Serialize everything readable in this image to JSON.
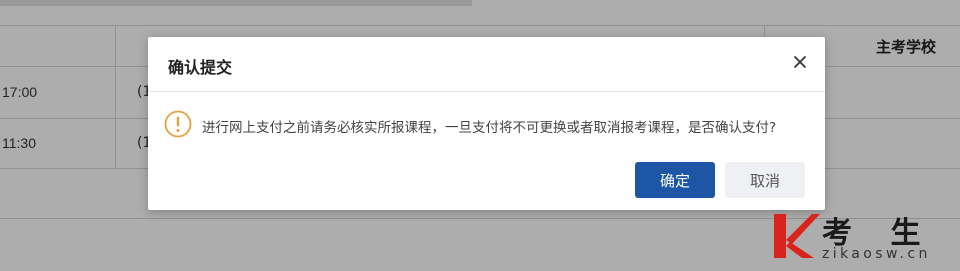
{
  "background": {
    "header_col_school": "主考学校",
    "rows": [
      {
        "time": "17:00",
        "paren": "(1"
      },
      {
        "time": "11:30",
        "paren": "(1"
      }
    ]
  },
  "dialog": {
    "title": "确认提交",
    "close_icon": "close-icon",
    "warning_icon": "warning-icon",
    "message": "进行网上支付之前请务必核实所报课程，一旦支付将不可更换或者取消报考课程，是否确认支付?",
    "confirm_label": "确定",
    "cancel_label": "取消",
    "accent_color": "#1c56a4",
    "warning_color": "#e6a23c"
  },
  "watermark": {
    "title": "考 生 网",
    "url": "zikaosw.cn"
  }
}
